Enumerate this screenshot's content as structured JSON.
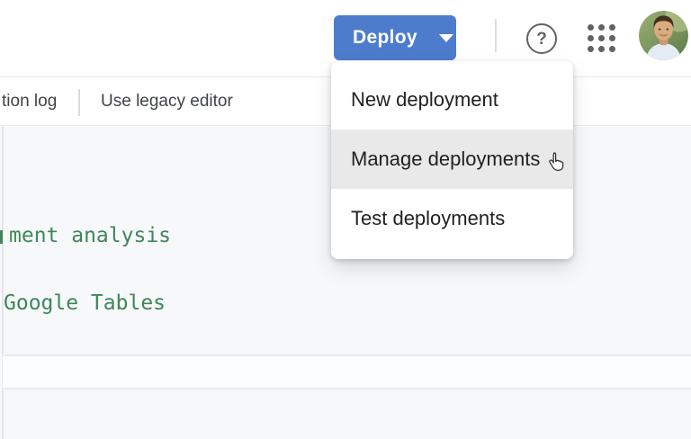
{
  "header": {
    "deploy_label": "Deploy"
  },
  "tab_bar": {
    "execution_log_label": "tion log",
    "use_legacy_editor_label": "Use legacy editor"
  },
  "deploy_menu": {
    "items": [
      {
        "label": "New deployment"
      },
      {
        "label": "Manage deployments"
      },
      {
        "label": "Test deployments"
      }
    ],
    "hovered_item": "Manage deployments"
  },
  "editor": {
    "visible_code_lines": [
      "ment analysis",
      "Google Tables"
    ]
  },
  "icons": {
    "deploy_caret": "caret-down",
    "help": "question-mark-circle",
    "apps": "grid-3x3-dots",
    "avatar": "user-photo",
    "hover_cursor": "pointing-hand-cursor"
  },
  "colors": {
    "deploy_button_blue": "#4d7ccd",
    "comment_green": "#3e8659",
    "menu_hover_gray": "#e9e9ea",
    "content_background": "#f7f8fa",
    "icon_gray": "#5f6368"
  }
}
